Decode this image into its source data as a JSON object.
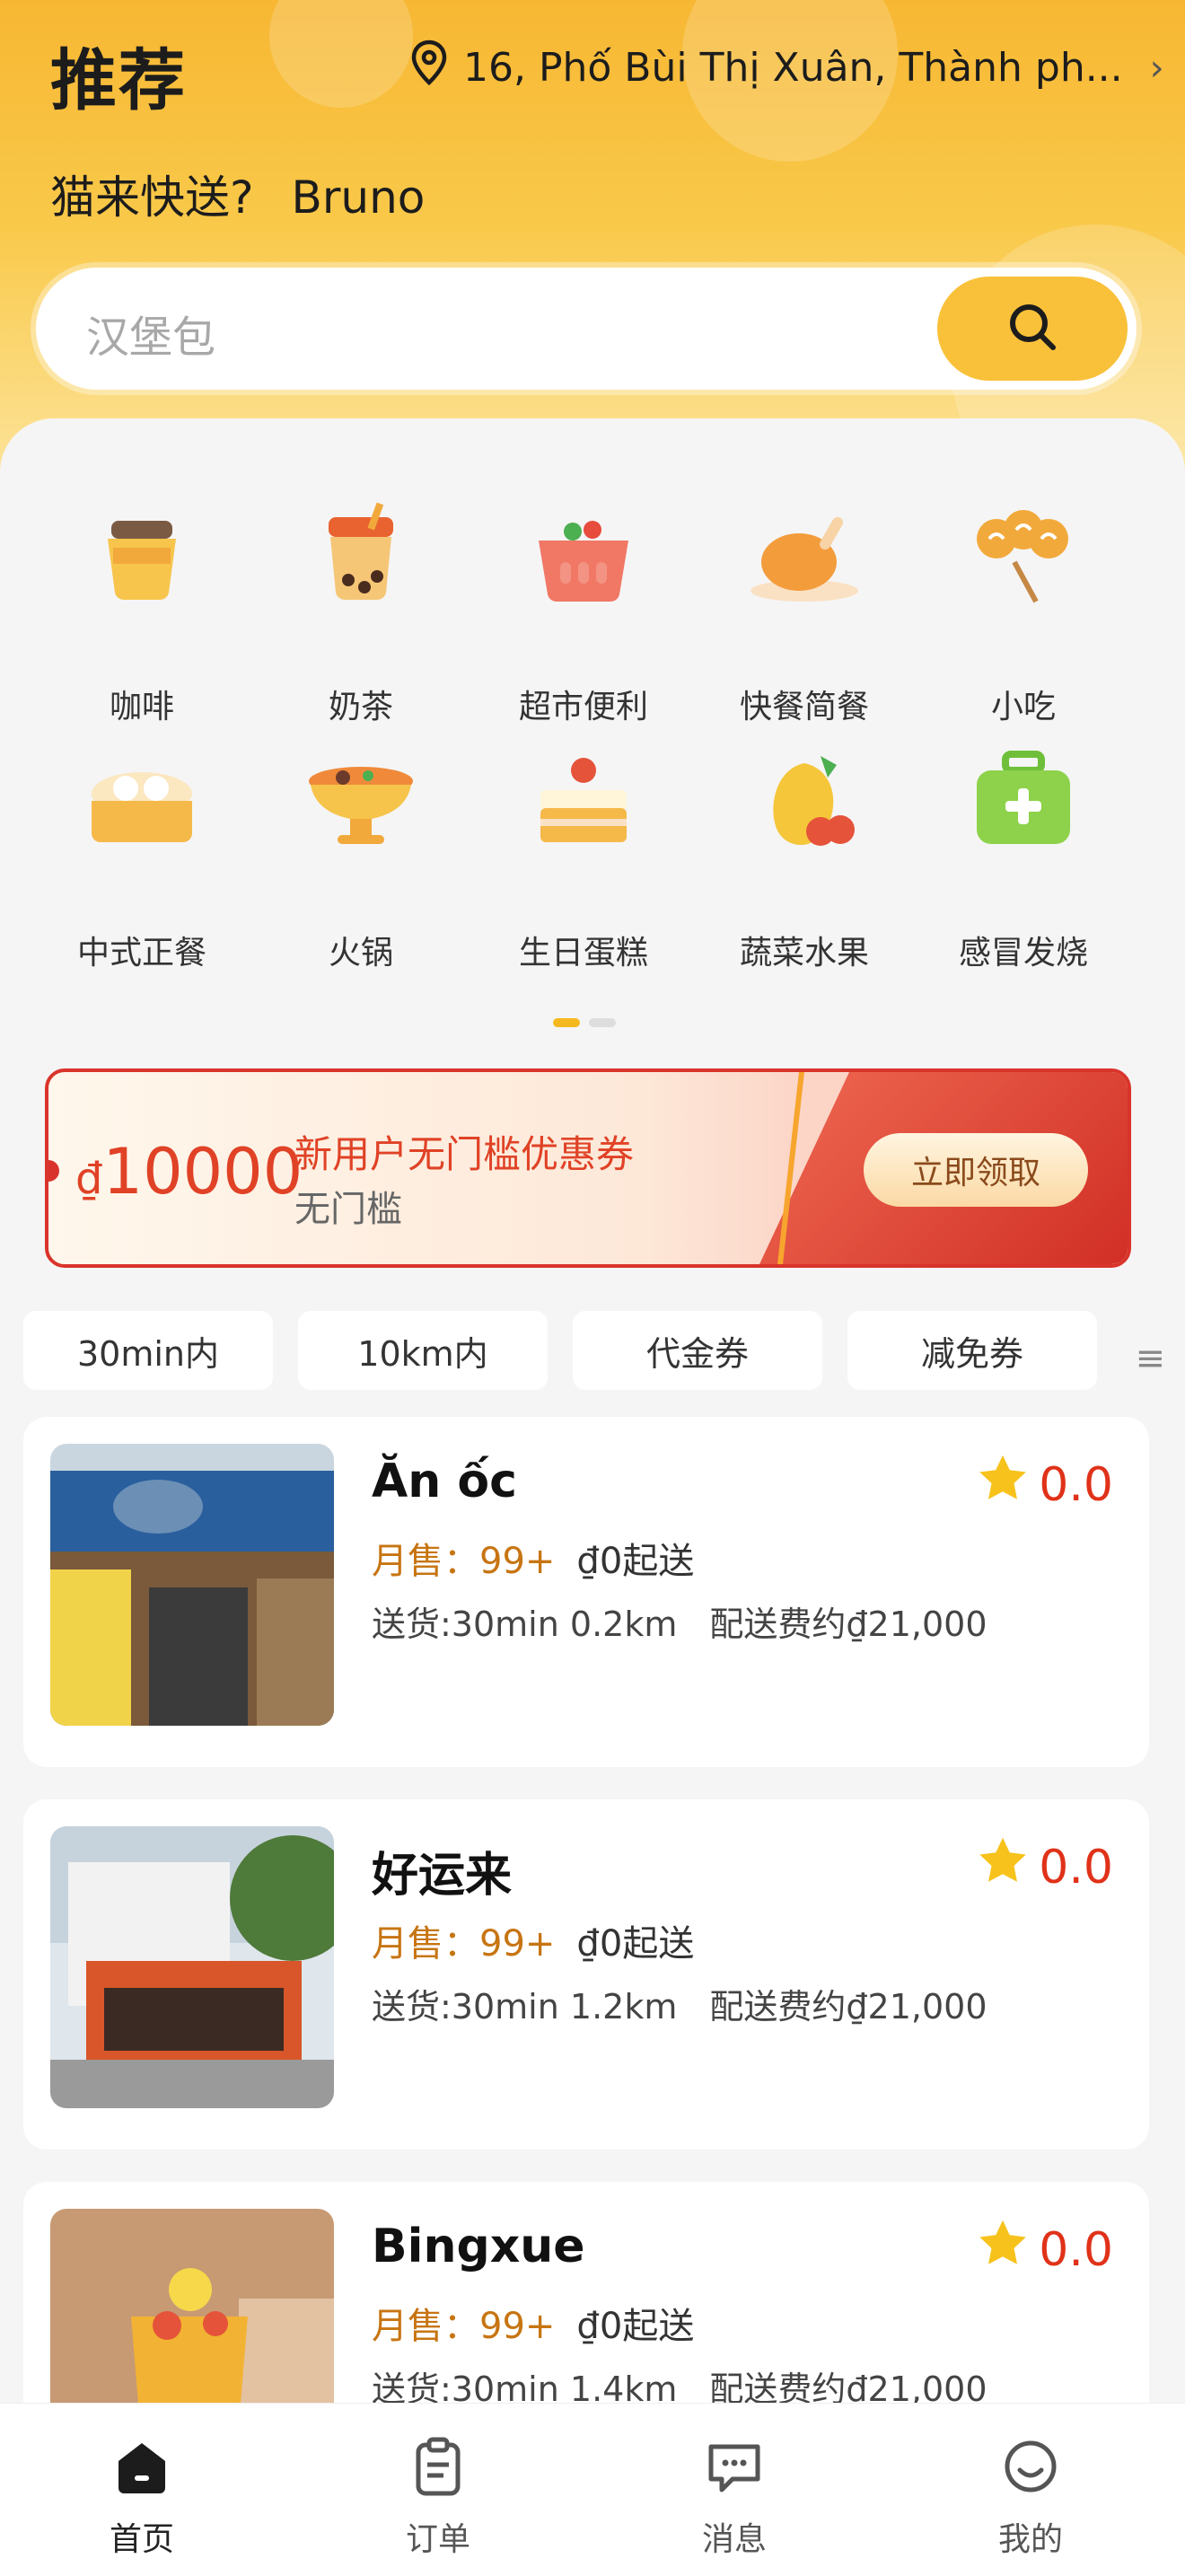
{
  "header": {
    "title": "推荐",
    "location": "16, Phố Bùi Thị Xuân, Thành ph...",
    "greeting": "猫来快送?",
    "user_name": "Bruno"
  },
  "search": {
    "placeholder": "汉堡包"
  },
  "categories": [
    {
      "label": "咖啡",
      "icon": "coffee-cup-icon"
    },
    {
      "label": "奶茶",
      "icon": "milk-tea-icon"
    },
    {
      "label": "超市便利",
      "icon": "basket-icon"
    },
    {
      "label": "快餐简餐",
      "icon": "roast-chicken-icon"
    },
    {
      "label": "小吃",
      "icon": "skewer-icon"
    },
    {
      "label": "中式正餐",
      "icon": "steamed-bun-icon"
    },
    {
      "label": "火锅",
      "icon": "hotpot-icon"
    },
    {
      "label": "生日蛋糕",
      "icon": "cake-icon"
    },
    {
      "label": "蔬菜水果",
      "icon": "fruit-icon"
    },
    {
      "label": "感冒发烧",
      "icon": "medical-kit-icon"
    }
  ],
  "pager": {
    "pages": 2,
    "active": 1
  },
  "coupon": {
    "currency": "₫",
    "amount": "10000",
    "title": "新用户无门槛优惠券",
    "subtitle": "无门槛",
    "claim_label": "立即领取"
  },
  "filters": [
    "30min内",
    "10km内",
    "代金券",
    "减免券"
  ],
  "stores": [
    {
      "name": "Ăn ốc",
      "rating": "0.0",
      "sales_label": "月售：",
      "sales": "99+",
      "min_order": "₫0起送",
      "delivery": "送货:30min 0.2km",
      "fee": "配送费约₫21,000"
    },
    {
      "name": "好运来",
      "rating": "0.0",
      "sales_label": "月售：",
      "sales": "99+",
      "min_order": "₫0起送",
      "delivery": "送货:30min 1.2km",
      "fee": "配送费约₫21,000"
    },
    {
      "name": "Bingxue",
      "rating": "0.0",
      "sales_label": "月售：",
      "sales": "99+",
      "min_order": "₫0起送",
      "delivery": "送货:30min 1.4km",
      "fee": "配送费约₫21,000"
    }
  ],
  "tabbar": [
    {
      "label": "首页",
      "icon": "home-icon",
      "active": true
    },
    {
      "label": "订单",
      "icon": "orders-icon",
      "active": false
    },
    {
      "label": "消息",
      "icon": "message-icon",
      "active": false
    },
    {
      "label": "我的",
      "icon": "profile-icon",
      "active": false
    }
  ],
  "colors": {
    "accent": "#f9c13a",
    "price_red": "#e03219",
    "sales": "#c77512"
  }
}
